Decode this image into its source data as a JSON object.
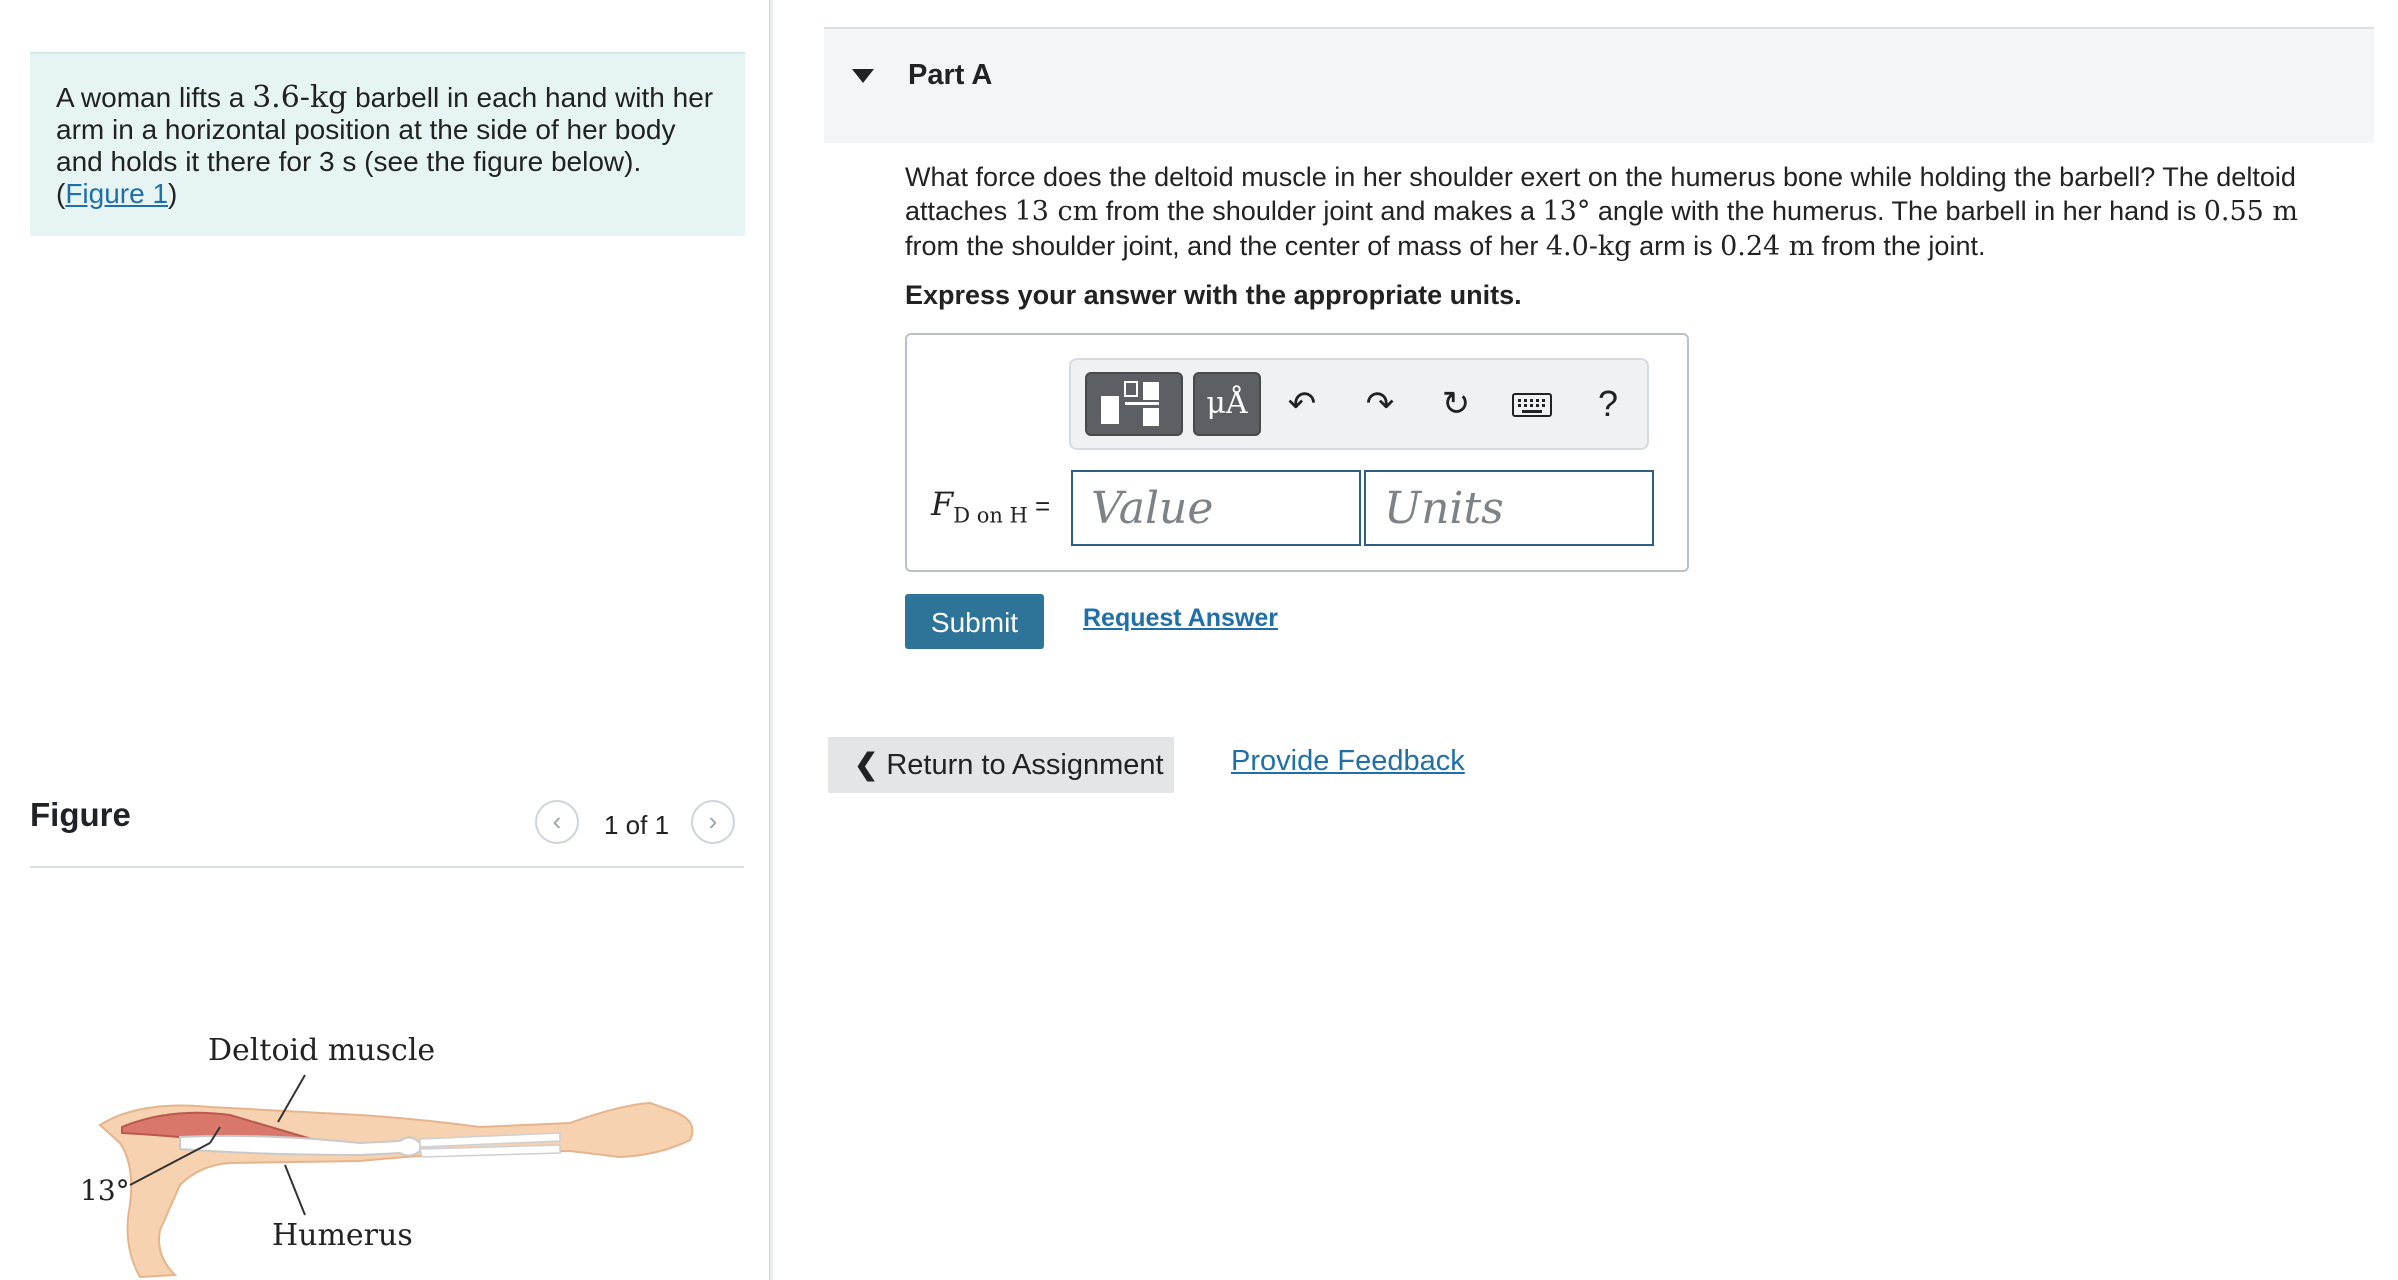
{
  "problem": {
    "text_part1": "A woman lifts a ",
    "mass": "3.6-kg",
    "text_part2": " barbell in each hand with her arm in a horizontal position at the side of her body and holds it there for ",
    "time": "3 s",
    "text_part3": " (see the figure below).",
    "figure_link_open": "(",
    "figure_link": "Figure 1",
    "figure_link_close": ")"
  },
  "figure": {
    "title": "Figure",
    "counter": "1 of 1",
    "prev_icon": "chevron-left-icon",
    "next_icon": "chevron-right-icon",
    "labels": {
      "deltoid": "Deltoid muscle",
      "angle": "13°",
      "humerus": "Humerus"
    }
  },
  "part": {
    "title": "Part A",
    "question_p1": "What force does the deltoid muscle in her shoulder exert on the humerus bone while holding the barbell? The deltoid attaches ",
    "q_dist1": "13 cm",
    "question_p2": " from the shoulder joint and makes a ",
    "q_angle": "13°",
    "question_p3": " angle with the humerus. The barbell in her hand is ",
    "q_dist2": "0.55 m",
    "question_p4": " from the shoulder joint, and the center of mass of her ",
    "q_mass": "4.0-kg",
    "question_p5": " arm is ",
    "q_dist3": "0.24 m",
    "question_p6": " from the joint.",
    "instruction": "Express your answer with the appropriate units."
  },
  "answer": {
    "label_main": "F",
    "label_sub": "D on H",
    "equals": "=",
    "value_placeholder": "Value",
    "units_placeholder": "Units",
    "toolbar": {
      "units_label": "μÅ",
      "undo_icon": "undo-icon",
      "redo_icon": "redo-icon",
      "reset_icon": "reset-icon",
      "keyboard_icon": "keyboard-icon",
      "help_label": "?"
    }
  },
  "actions": {
    "submit": "Submit",
    "request_answer": "Request Answer",
    "return": "Return to Assignment",
    "feedback": "Provide Feedback"
  }
}
